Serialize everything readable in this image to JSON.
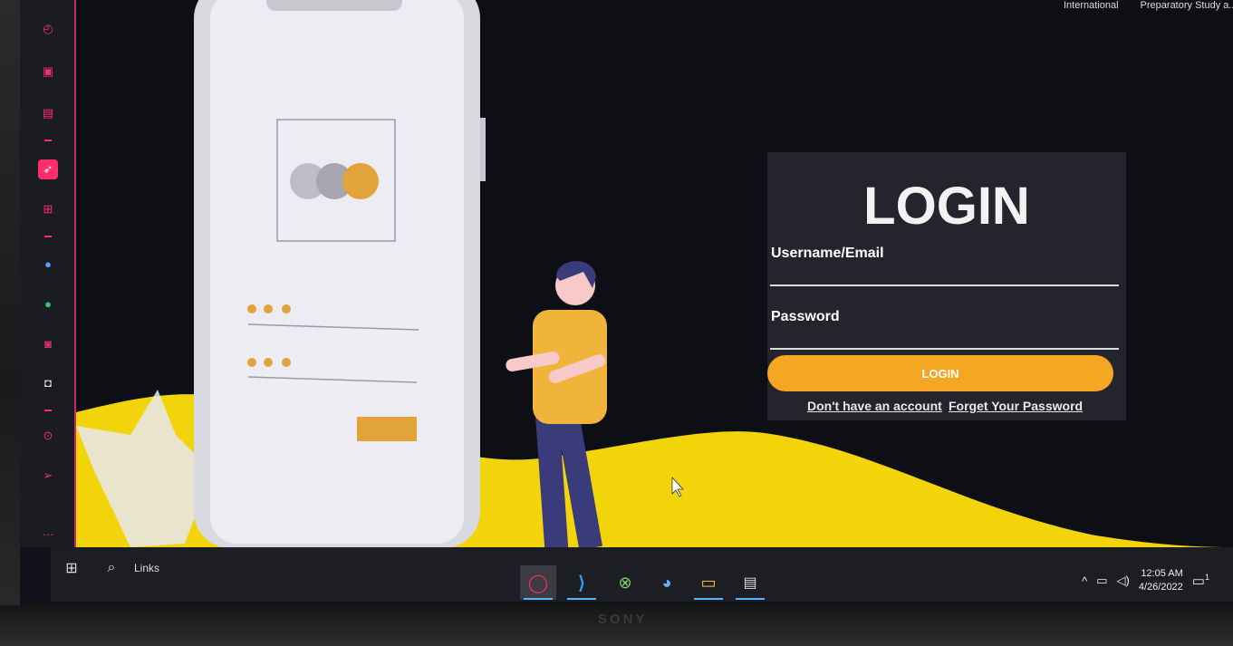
{
  "bookmarks": {
    "items": [
      "International",
      "Preparatory Study a..."
    ]
  },
  "login": {
    "title": "LOGIN",
    "username_label": "Username/Email",
    "username_value": "",
    "password_label": "Password",
    "password_value": "",
    "button_label": "LOGIN",
    "signup_link": "Don't have an account",
    "forgot_link": "Forget Your Password"
  },
  "taskbar": {
    "search_label": "Links",
    "time": "12:05 AM",
    "date": "4/26/2022",
    "notification_count": "1"
  },
  "colors": {
    "accent": "#f5a623",
    "sidebar_accent": "#ff2e6a",
    "wave": "#f2d40a",
    "panel": "#23242c"
  },
  "monitor": {
    "brand": "SONY"
  }
}
